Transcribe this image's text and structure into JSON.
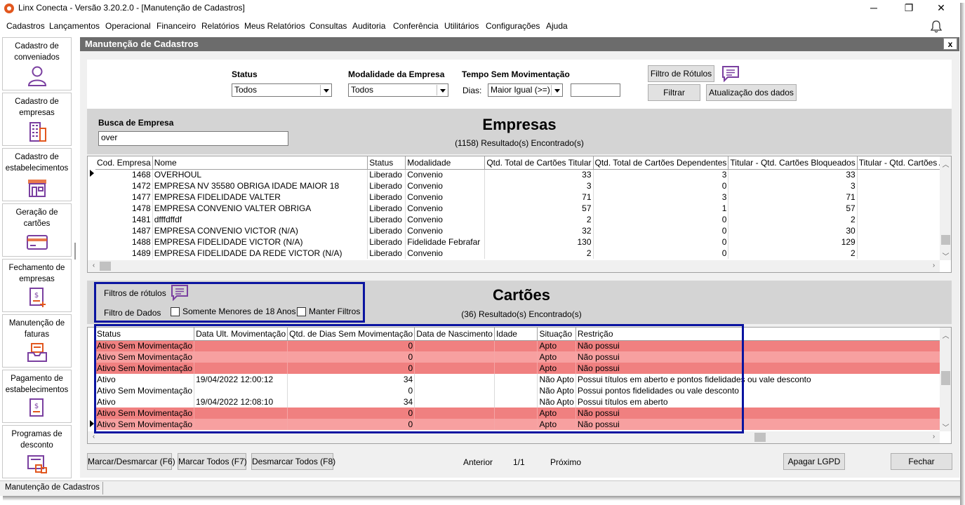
{
  "window": {
    "title": "Linx Conecta - Versão 3.20.2.0 - [Manutenção de Cadastros]",
    "minimize_glyph": "─",
    "maximize_glyph": "❐",
    "close_glyph": "✕"
  },
  "menu": [
    "Cadastros",
    "Lançamentos",
    "Operacional",
    "Financeiro",
    "Relatórios",
    "Meus Relatórios",
    "Consultas",
    "Auditoria",
    "Conferência",
    "Utilitários",
    "Configurações",
    "Ajuda"
  ],
  "sidebar": [
    {
      "label": "Cadastro de conveniados",
      "icon": "person-icon"
    },
    {
      "label": "Cadastro de empresas",
      "icon": "building-icon"
    },
    {
      "label": "Cadastro de estabelecimentos",
      "icon": "store-icon"
    },
    {
      "label": "Geração de cartões",
      "icon": "card-icon"
    },
    {
      "label": "Fechamento de empresas",
      "icon": "invoice-close-icon"
    },
    {
      "label": "Manutenção de faturas",
      "icon": "inbox-tray-icon"
    },
    {
      "label": "Pagamento de estabelecimentos",
      "icon": "payment-icon"
    },
    {
      "label": "Programas de desconto",
      "icon": "discount-program-icon"
    }
  ],
  "inner": {
    "title": "Manutenção de Cadastros",
    "close": "x"
  },
  "filters": {
    "status_label": "Status",
    "status_value": "Todos",
    "modalidade_label": "Modalidade da Empresa",
    "modalidade_value": "Todos",
    "tempo_label": "Tempo Sem Movimentação",
    "dias_label": "Dias:",
    "dias_op": "Maior Igual (>=)",
    "dias_value": "",
    "filtro_rotulos_btn": "Filtro de Rótulos",
    "filtrar_btn": "Filtrar",
    "atualizacao_btn": "Atualização dos dados"
  },
  "busca": {
    "label": "Busca de Empresa",
    "value": "over"
  },
  "empresas": {
    "title": "Empresas",
    "count": "(1158) Resultado(s) Encontrado(s)",
    "columns": [
      "Cod. Empresa",
      "Nome",
      "Status",
      "Modalidade",
      "Qtd. Total de Cartões Titular",
      "Qtd. Total de Cartões Dependentes",
      "Titular - Qtd. Cartões Bloqueados",
      "Titular - Qtd. Cartões Ati"
    ],
    "rows": [
      [
        "1468",
        "OVERHOUL",
        "Liberado",
        "Convenio",
        "33",
        "3",
        "33",
        ""
      ],
      [
        "1472",
        "EMPRESA NV 35580 OBRIGA IDADE MAIOR 18",
        "Liberado",
        "Convenio",
        "3",
        "0",
        "3",
        ""
      ],
      [
        "1477",
        "EMPRESA FIDELIDADE VALTER",
        "Liberado",
        "Convenio",
        "71",
        "3",
        "71",
        ""
      ],
      [
        "1478",
        "EMPRESA CONVENIO VALTER OBRIGA",
        "Liberado",
        "Convenio",
        "57",
        "1",
        "57",
        ""
      ],
      [
        "1481",
        "dfffdffdf",
        "Liberado",
        "Convenio",
        "2",
        "0",
        "2",
        ""
      ],
      [
        "1487",
        "EMPRESA CONVENIO VICTOR (N/A)",
        "Liberado",
        "Convenio",
        "32",
        "0",
        "30",
        ""
      ],
      [
        "1488",
        " EMPRESA FIDELIDADE VICTOR (N/A)",
        "Liberado",
        "Fidelidade Febrafar",
        "130",
        "0",
        "129",
        ""
      ],
      [
        "1489",
        "EMPRESA FIDELIDADE DA REDE VICTOR (N/A)",
        "Liberado",
        "Convenio",
        "2",
        "0",
        "2",
        ""
      ]
    ]
  },
  "cartoes_filters": {
    "rotulos_label": "Filtros de rótulos",
    "dados_label": "Filtro de Dados",
    "menores_label": "Somente Menores de 18 Anos",
    "manter_label": "Manter Filtros"
  },
  "cartoes": {
    "title": "Cartões",
    "count": "(36) Resultado(s) Encontrado(s)",
    "columns": [
      "Status",
      "Data Ult. Movimentação",
      "Qtd. de Dias Sem Movimentação",
      "Data de Nascimento",
      "Idade",
      "Situação",
      "Restrição"
    ],
    "rows": [
      [
        "Ativo Sem Movimentação",
        "",
        "0",
        "",
        "",
        "Apto",
        "Não possui"
      ],
      [
        "Ativo Sem Movimentação",
        "",
        "0",
        "",
        "",
        "Apto",
        "Não possui"
      ],
      [
        "Ativo Sem Movimentação",
        "",
        "0",
        "",
        "",
        "Apto",
        "Não possui"
      ],
      [
        "Ativo",
        "19/04/2022 12:00:12",
        "34",
        "",
        "",
        "Não Apto",
        "Possui títulos em aberto e pontos fidelidades ou vale desconto"
      ],
      [
        "Ativo Sem Movimentação",
        "",
        "0",
        "",
        "",
        "Não Apto",
        "Possui pontos fidelidades ou vale desconto"
      ],
      [
        "Ativo",
        "19/04/2022 12:08:10",
        "34",
        "",
        "",
        "Não Apto",
        "Possui títulos em aberto"
      ],
      [
        "Ativo Sem Movimentação",
        "",
        "0",
        "",
        "",
        "Apto",
        "Não possui"
      ],
      [
        "Ativo Sem Movimentação",
        "",
        "0",
        "",
        "",
        "Apto",
        "Não possui"
      ]
    ]
  },
  "bottom": {
    "marcar_desmarcar": "Marcar/Desmarcar (F6)",
    "marcar_todos": "Marcar Todos (F7)",
    "desmarcar_todos": "Desmarcar Todos (F8)",
    "anterior": "Anterior",
    "page": "1/1",
    "proximo": "Próximo",
    "apagar_lgpd": "Apagar LGPD",
    "fechar": "Fechar"
  },
  "status_bar": "Manutenção de Cadastros",
  "colors": {
    "accent": "#7a3fa0",
    "highlight_row": "#f08080",
    "selection_box": "#0a14a0",
    "header_bar": "#6c6c6c"
  }
}
